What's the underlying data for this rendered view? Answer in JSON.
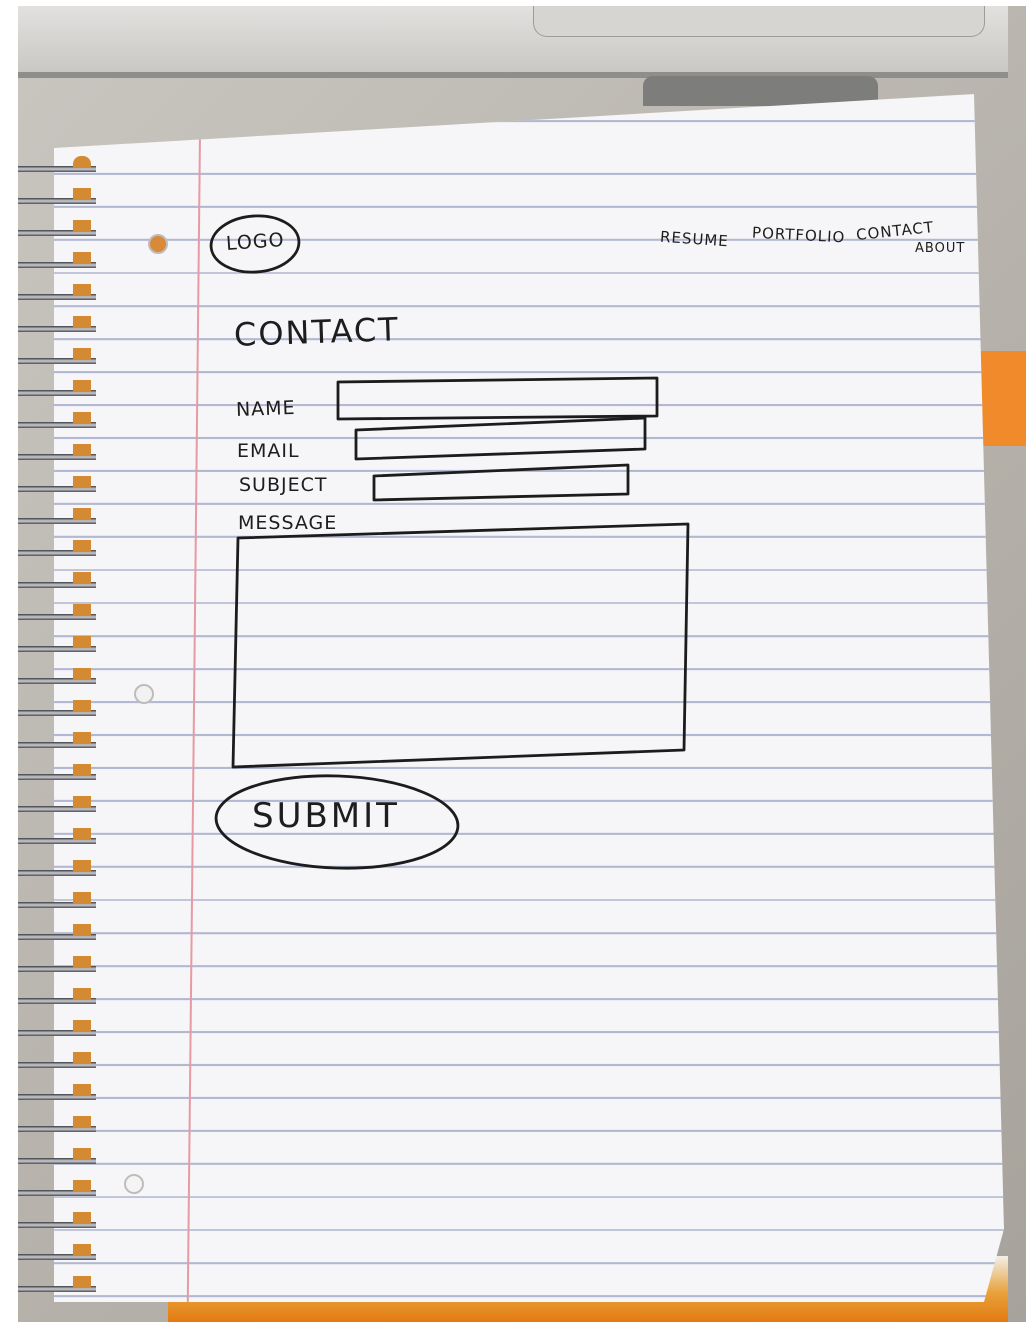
{
  "sketch": {
    "logo": "LOGO",
    "nav": {
      "resume": "RESUME",
      "portfolio": "PORTFOLIO",
      "contact": "CONTACT",
      "about": "ABOUT"
    },
    "heading": "CONTACT",
    "form": {
      "name_label": "NAME",
      "email_label": "EMAIL",
      "subject_label": "SUBJECT",
      "message_label": "MESSAGE",
      "submit_label": "SUBMIT"
    }
  },
  "colors": {
    "ink": "#1c1c1c",
    "paper": "#f6f5f7",
    "rule_lines": "#b3b8d2",
    "margin_line": "#e79aa3",
    "orange": "#e47a11"
  }
}
